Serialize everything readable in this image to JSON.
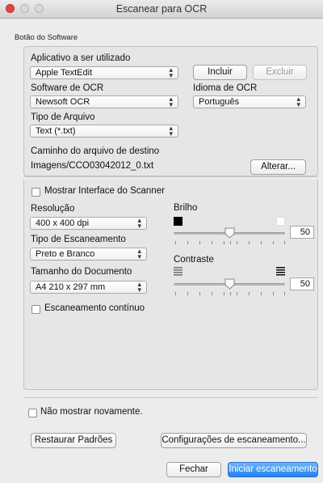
{
  "window": {
    "title": "Escanear para OCR"
  },
  "group_label": "Botão do Software",
  "app_section": {
    "label": "Aplicativo a ser utilizado",
    "app_value": "Apple TextEdit",
    "add_button": "Incluir",
    "remove_button": "Excluir",
    "ocr_software_label": "Software de OCR",
    "ocr_software_value": "Newsoft OCR",
    "ocr_language_label": "Idioma de OCR",
    "ocr_language_value": "Português",
    "file_type_label": "Tipo de Arquivo",
    "file_type_value": "Text (*.txt)",
    "dest_path_label": "Caminho do arquivo de destino",
    "dest_path_value": "Imagens/CCO03042012_0.txt",
    "change_button": "Alterar..."
  },
  "scan_section": {
    "show_scanner_ui_label": "Mostrar Interface do Scanner",
    "resolution_label": "Resolução",
    "resolution_value": "400 x 400 dpi",
    "scan_type_label": "Tipo de Escaneamento",
    "scan_type_value": "Preto e Branco",
    "doc_size_label": "Tamanho do Documento",
    "doc_size_value": "A4 210 x 297 mm",
    "continuous_label": "Escaneamento contínuo",
    "brightness_label": "Brilho",
    "brightness_value": "50",
    "contrast_label": "Contraste",
    "contrast_value": "50"
  },
  "footer": {
    "dont_show_label": "Não mostrar novamente.",
    "restore_button": "Restaurar Padrões",
    "scan_settings_button": "Configurações de escaneamento...",
    "close_button": "Fechar",
    "start_button": "Iniciar escaneamento"
  },
  "icons": {
    "popup_arrows": "up-down-chevrons",
    "contrast_low": "contrast-low-icon",
    "contrast_high": "contrast-high-icon"
  },
  "colors": {
    "accent": "#1f84f0",
    "close_dot": "#e0443e"
  }
}
